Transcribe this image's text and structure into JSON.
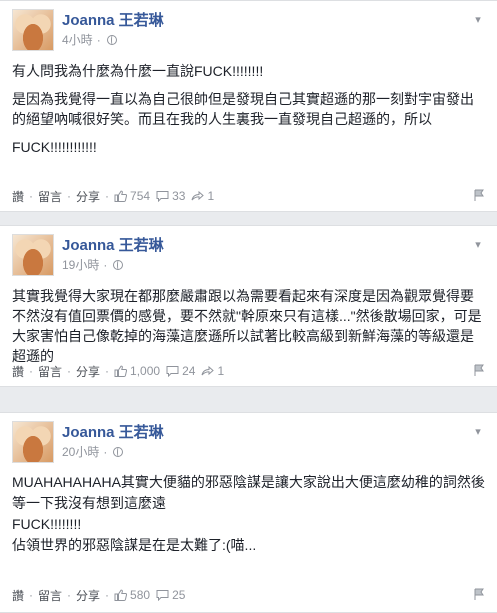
{
  "posts": [
    {
      "author": "Joanna 王若琳",
      "time": "4小時",
      "paragraphs": [
        "有人問我為什麼為什麼一直說FUCK!!!!!!!!",
        "是因為我覺得一直以為自己很帥但是發現自己其實超遜的那一刻對宇宙發出的絕望吶喊很好笑。而且在我的人生裏我一直發現自己超遜的，所以",
        "FUCK!!!!!!!!!!!!"
      ],
      "actions": {
        "like": "讚",
        "comment": "留言",
        "share": "分享"
      },
      "stats": {
        "likes": "754",
        "comments": "33",
        "shares": "1"
      }
    },
    {
      "author": "Joanna 王若琳",
      "time": "19小時",
      "paragraphs": [
        "其實我覺得大家現在都那麼嚴肅跟以為需要看起來有深度是因為觀眾覺得要不然沒有值回票價的感覺，要不然就\"幹原來只有這樣...\"然後散場回家，可是大家害怕自己像乾掉的海藻這麼遜所以試著比較高級到新鮮海藻的等級還是超遜的"
      ],
      "actions": {
        "like": "讚",
        "comment": "留言",
        "share": "分享"
      },
      "stats": {
        "likes": "1,000",
        "comments": "24",
        "shares": "1"
      }
    },
    {
      "author": "Joanna 王若琳",
      "time": "20小時",
      "paragraphs": [
        "MUAHAHAHAHA其實大便貓的邪惡陰謀是讓大家說出大便這麼幼稚的詞然後",
        "等一下我沒有想到這麼遠",
        "FUCK!!!!!!!!",
        "佔領世界的邪惡陰謀是在是太難了:(喵..."
      ],
      "actions": {
        "like": "讚",
        "comment": "留言",
        "share": "分享"
      },
      "stats": {
        "likes": "580",
        "comments": "25"
      }
    }
  ],
  "icons": {
    "like": "thumbs-up-icon",
    "comment": "comment-icon",
    "share": "share-arrow-icon",
    "flag": "flag-icon",
    "privacy": "globe-icon",
    "menu": "chevron-down-icon"
  },
  "colors": {
    "name": "#365899",
    "meta": "#90949c",
    "text": "#1d2129",
    "background": "#e9ebee"
  }
}
